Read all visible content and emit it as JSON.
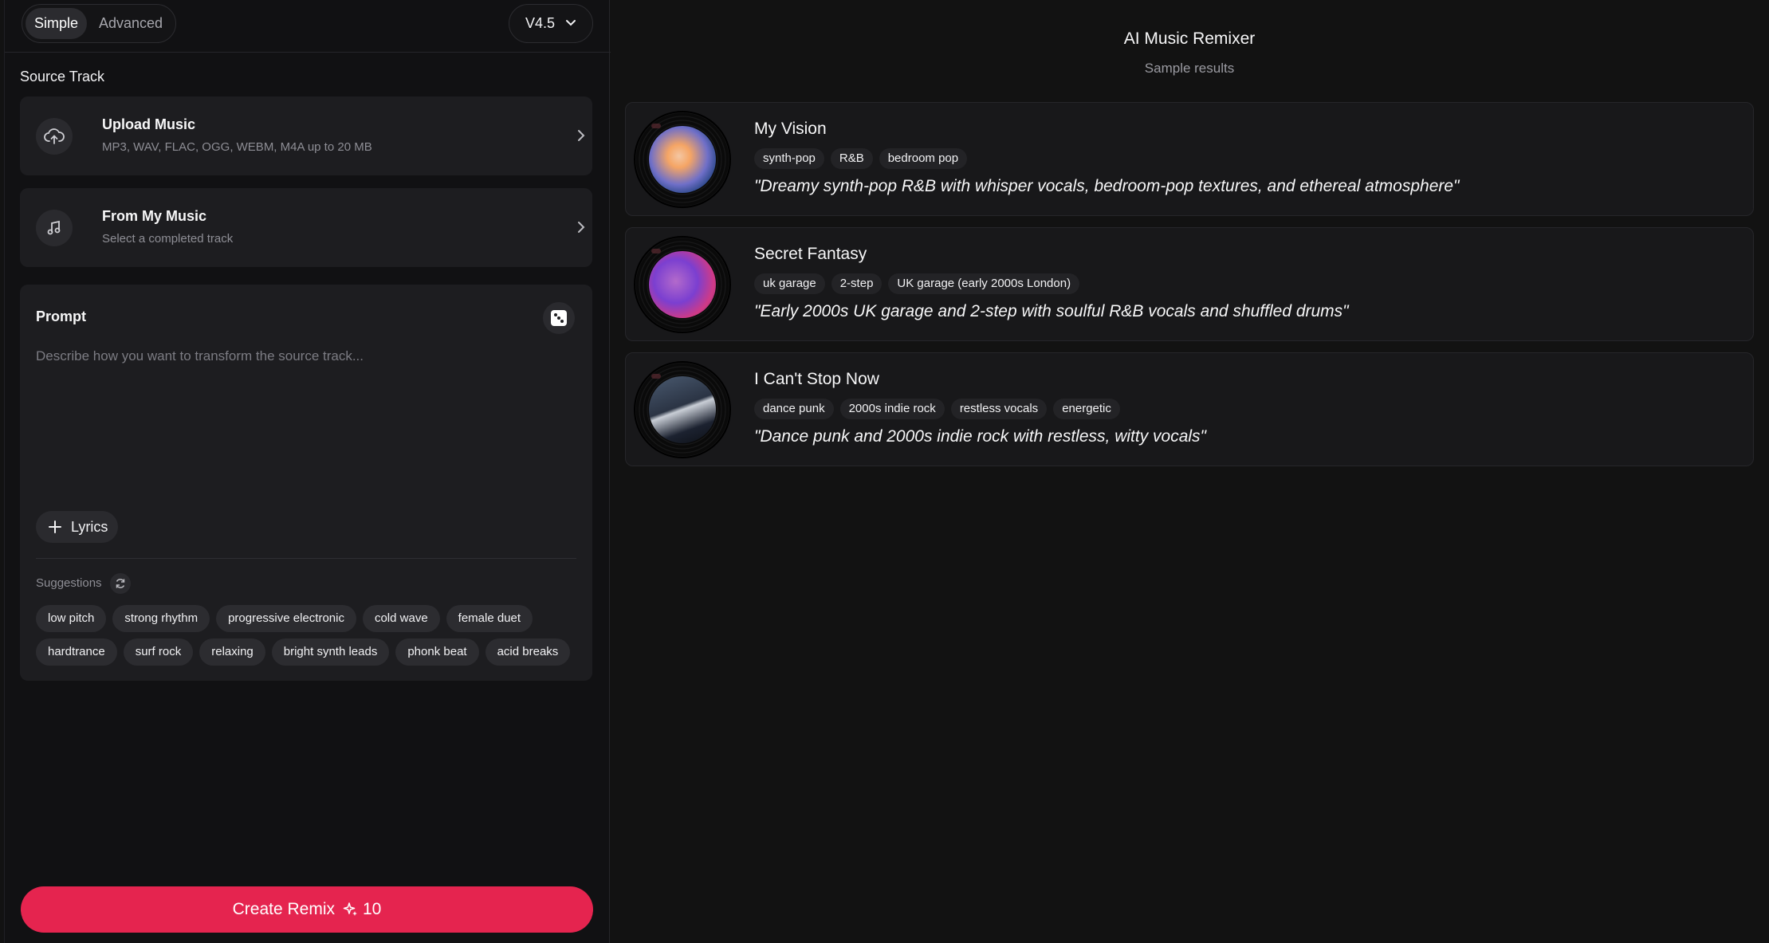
{
  "mode_toggle": {
    "simple": "Simple",
    "advanced": "Advanced",
    "active": "Simple"
  },
  "version": {
    "label": "V4.5"
  },
  "source_track": {
    "label": "Source Track",
    "upload": {
      "title": "Upload Music",
      "subtitle": "MP3, WAV, FLAC, OGG, WEBM, M4A up to 20 MB",
      "icon": "cloud-upload-icon"
    },
    "my_music": {
      "title": "From My Music",
      "subtitle": "Select a completed track",
      "icon": "music-note-icon"
    }
  },
  "prompt": {
    "title": "Prompt",
    "placeholder": "Describe how you want to transform the source track...",
    "value": "",
    "lyrics_label": "Lyrics",
    "suggestions_label": "Suggestions",
    "suggestions_row1": [
      "low pitch",
      "strong rhythm",
      "progressive electronic",
      "cold wave",
      "female duet"
    ],
    "suggestions_row2": [
      "hardtrance",
      "surf rock",
      "relaxing",
      "bright synth leads",
      "phonk beat",
      "acid breaks"
    ]
  },
  "create_button": {
    "label": "Create Remix",
    "credits": "10",
    "color": "#e5244f"
  },
  "results_header": {
    "title": "AI Music Remixer",
    "subtitle": "Sample results"
  },
  "results": [
    {
      "title": "My Vision",
      "tags": [
        "synth-pop",
        "R&B",
        "bedroom pop"
      ],
      "description": "\"Dreamy synth-pop R&B with whisper vocals, bedroom-pop textures, and ethereal atmosphere\""
    },
    {
      "title": "Secret Fantasy",
      "tags": [
        "uk garage",
        "2-step",
        "UK garage (early 2000s London)"
      ],
      "description": "\"Early 2000s UK garage and 2-step with soulful R&B vocals and shuffled drums\""
    },
    {
      "title": "I Can't Stop Now",
      "tags": [
        "dance punk",
        "2000s indie rock",
        "restless vocals",
        "energetic"
      ],
      "description": "\"Dance punk and 2000s indie rock with restless, witty vocals\""
    }
  ]
}
